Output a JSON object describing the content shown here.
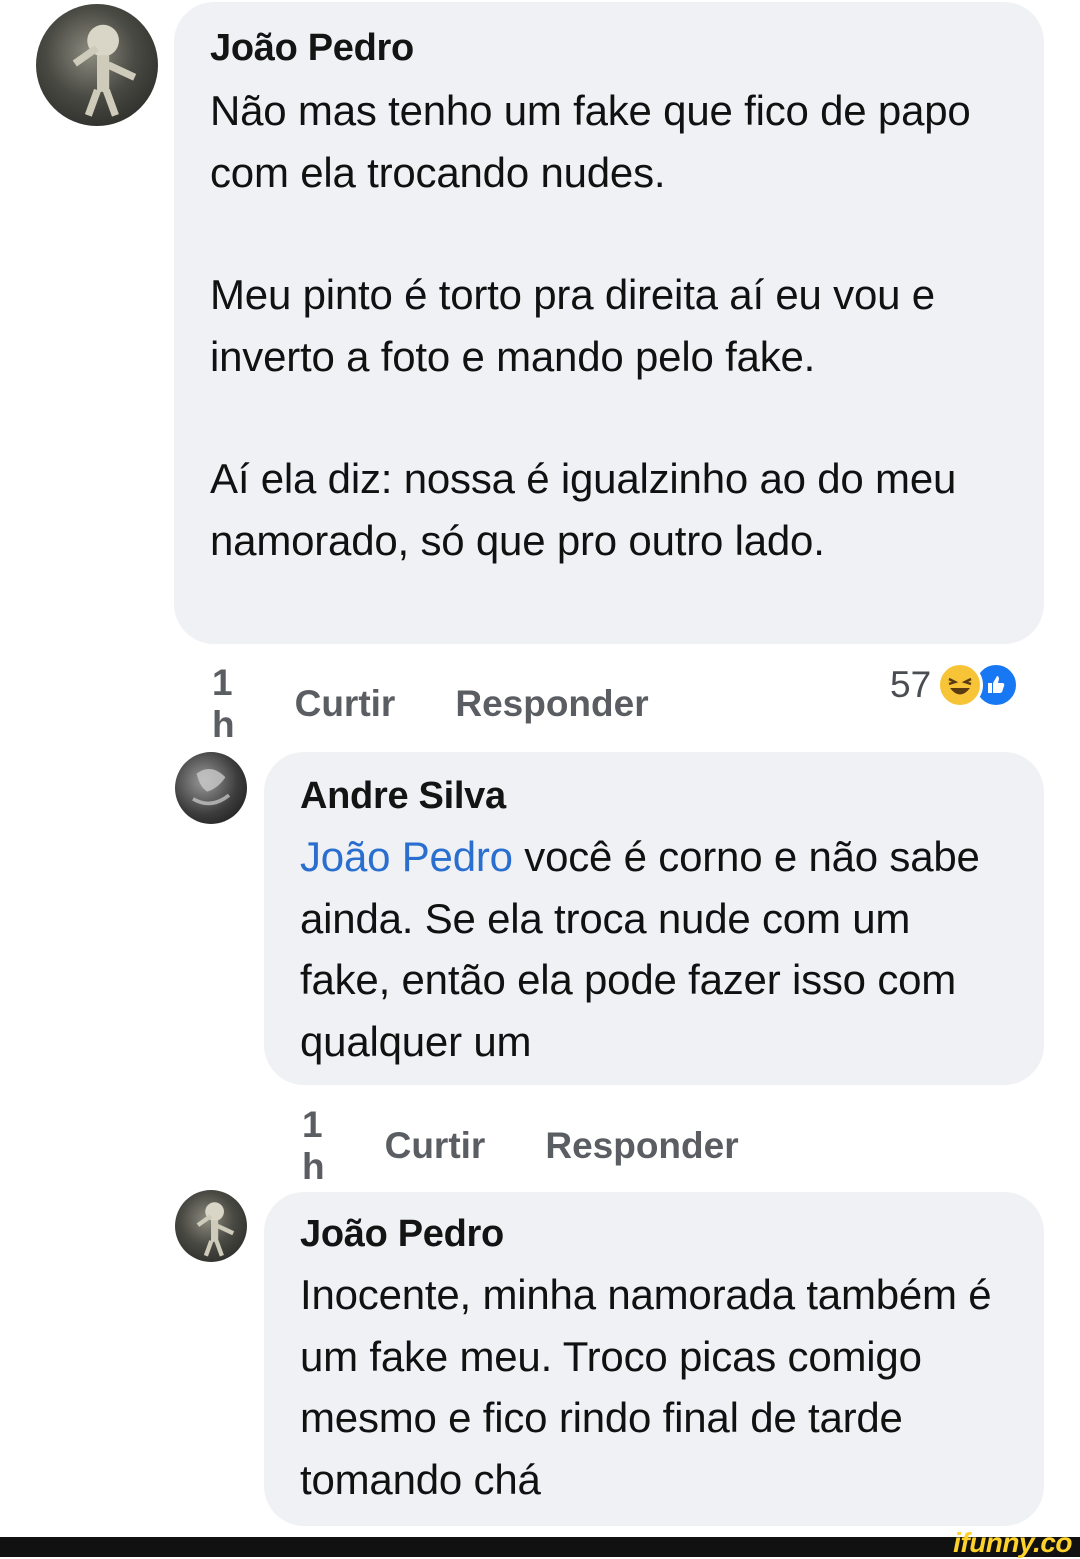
{
  "comments": [
    {
      "author": "João Pedro",
      "paragraphs": [
        "Não mas tenho um fake que fico de papo com ela trocando nudes.",
        "Meu pinto é torto pra direita aí eu vou e inverto a foto e mando pelo fake.",
        "Aí ela diz: nossa é igualzinho ao do meu namorado, só que pro outro lado."
      ],
      "time": "1 h",
      "like_label": "Curtir",
      "reply_label": "Responder",
      "reaction_count": "57",
      "reaction_icons": [
        "haha-icon",
        "like-icon"
      ]
    },
    {
      "author": "Andre Silva",
      "mention": "João Pedro",
      "text": " você é corno e não sabe ainda. Se ela troca nude com um fake, então ela pode fazer isso com qualquer um",
      "time": "1 h",
      "like_label": "Curtir",
      "reply_label": "Responder"
    },
    {
      "author": "João Pedro",
      "text": "Inocente, minha namorada também é um fake meu. Troco picas comigo mesmo e fico rindo final de tarde tomando chá"
    }
  ],
  "watermark": "ifunny.co",
  "colors": {
    "bubble": "#eff1f4",
    "mention": "#2a6fcf",
    "watermark": "#ffd12b"
  }
}
